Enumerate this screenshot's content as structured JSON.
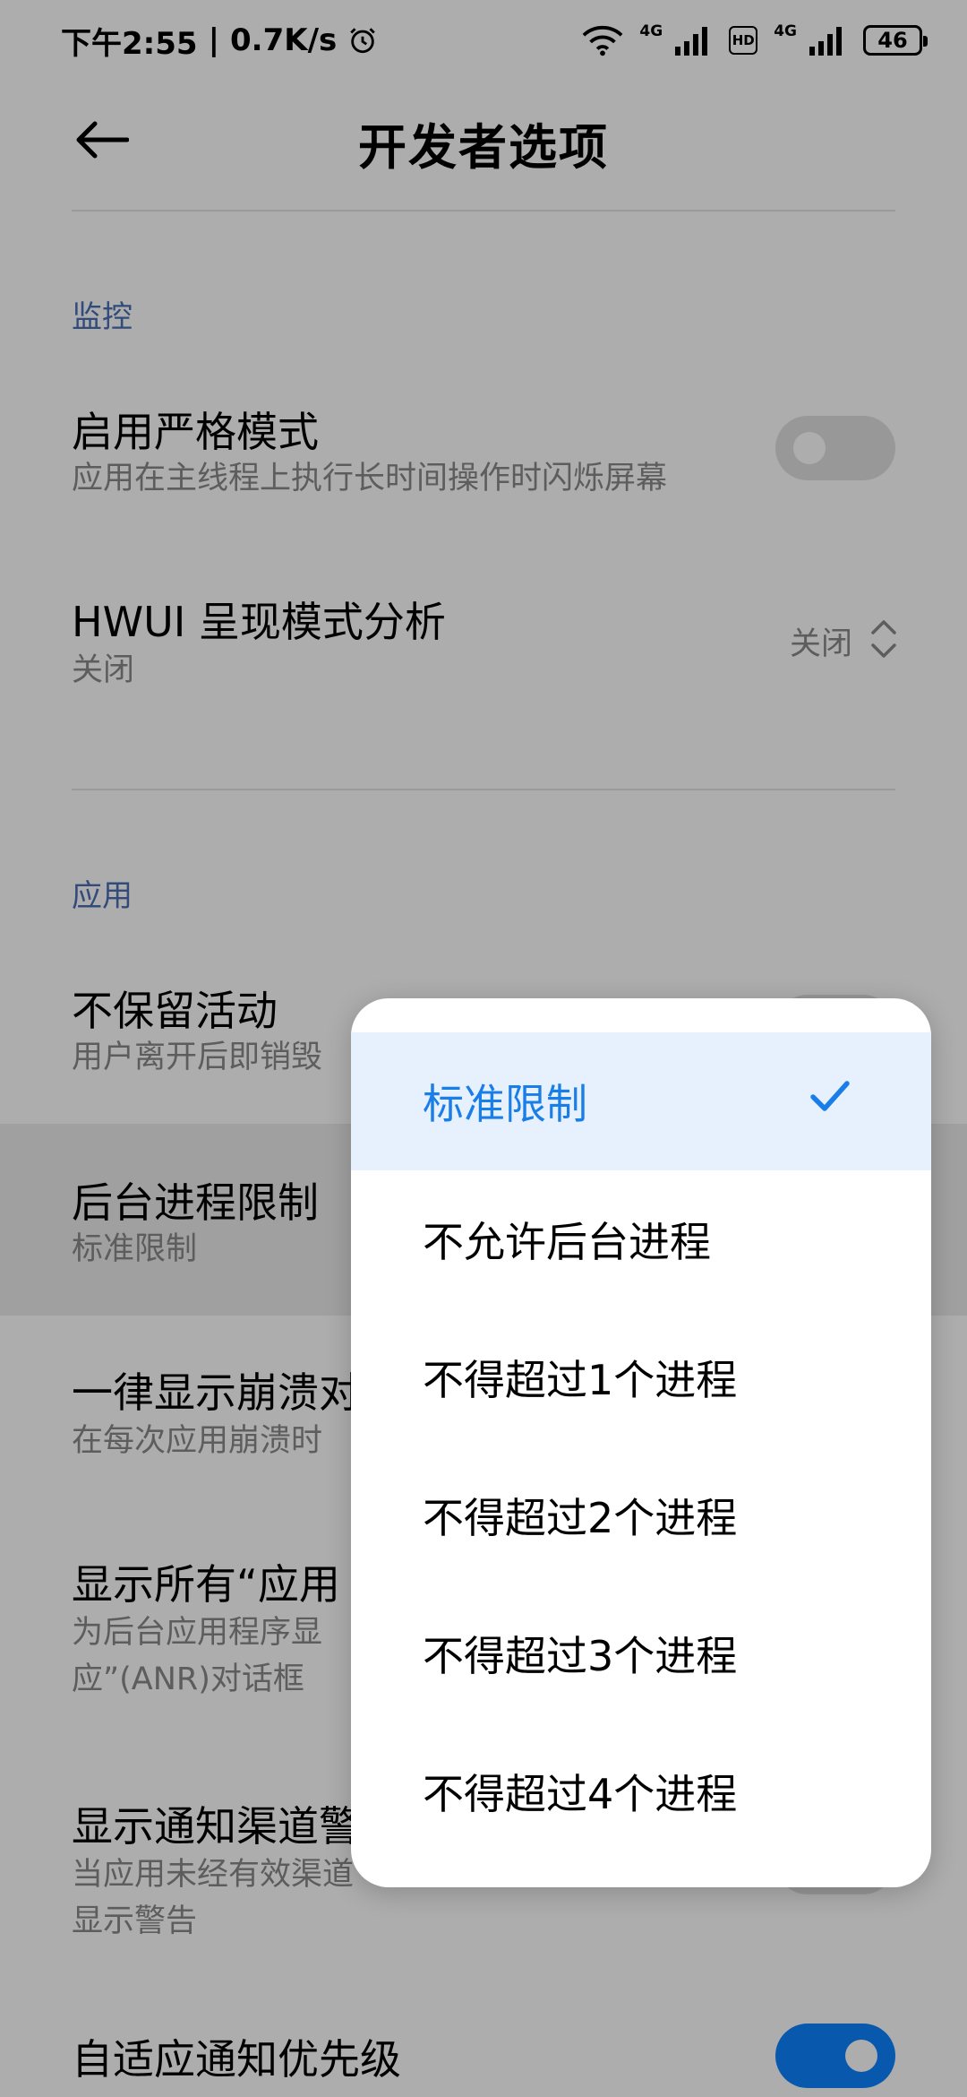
{
  "status_bar": {
    "time": "下午2:55",
    "separator": "|",
    "speed": "0.7K/s",
    "net1": "4G",
    "hd": "HD",
    "net2": "4G",
    "battery": "46"
  },
  "header": {
    "title": "开发者选项"
  },
  "sections": {
    "monitoring": {
      "title": "监控",
      "strict_mode": {
        "title": "启用严格模式",
        "subtitle": "应用在主线程上执行长时间操作时闪烁屏幕"
      },
      "hwui": {
        "title": "HWUI 呈现模式分析",
        "subtitle": "关闭",
        "value": "关闭"
      }
    },
    "apps": {
      "title": "应用",
      "dont_keep": {
        "title": "不保留活动",
        "subtitle": "用户离开后即销毁"
      },
      "bg_limit": {
        "title": "后台进程限制",
        "subtitle": "标准限制"
      },
      "crash": {
        "title": "一律显示崩溃对",
        "subtitle": "在每次应用崩溃时"
      },
      "anr": {
        "title": "显示所有“应用",
        "subtitle_line1": "为后台应用程序显",
        "subtitle_line2": "应”(ANR)对话框"
      },
      "channel": {
        "title": "显示通知渠道警",
        "subtitle_line1": "当应用未经有效渠道",
        "subtitle_line2": "显示警告"
      },
      "adaptive": {
        "title": "自适应通知优先级"
      }
    }
  },
  "popup": {
    "options": [
      {
        "label": "标准限制",
        "selected": true
      },
      {
        "label": "不允许后台进程",
        "selected": false
      },
      {
        "label": "不得超过1个进程",
        "selected": false
      },
      {
        "label": "不得超过2个进程",
        "selected": false
      },
      {
        "label": "不得超过3个进程",
        "selected": false
      },
      {
        "label": "不得超过4个进程",
        "selected": false
      }
    ]
  },
  "colors": {
    "accent": "#1a7ee8",
    "switch_on": "#0d84ff",
    "section": "#4a6fb5"
  },
  "icons": [
    "back-arrow-icon",
    "wifi-icon",
    "signal-icon",
    "alarm-icon",
    "expand-icon",
    "check-icon"
  ]
}
